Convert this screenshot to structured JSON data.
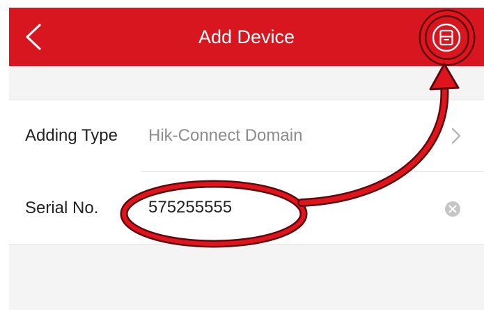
{
  "header": {
    "title": "Add Device",
    "back_icon": "chevron-left-icon",
    "save_icon": "save-icon",
    "background_color": "#d7161f",
    "text_color": "#ffffff"
  },
  "form": {
    "adding_type": {
      "label": "Adding Type",
      "value": "Hik-Connect Domain",
      "icon": "chevron-right-icon"
    },
    "serial_no": {
      "label": "Serial No.",
      "value": "575255555",
      "clear_icon": "clear-icon"
    }
  },
  "annotation": {
    "color": "#e0141c",
    "highlight_ellipse_icon": "highlight-ellipse",
    "arrow_icon": "curved-arrow"
  }
}
